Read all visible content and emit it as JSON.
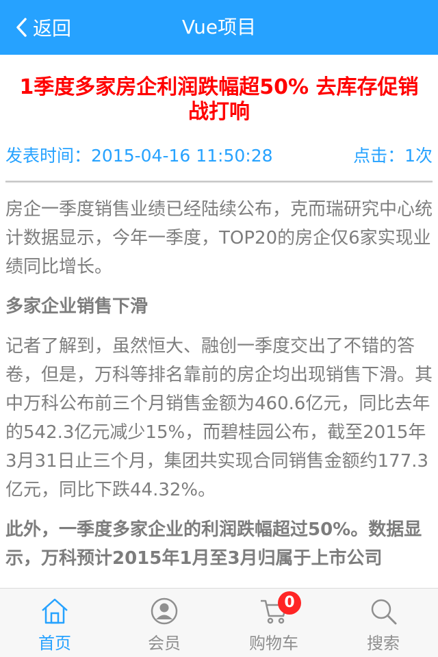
{
  "header": {
    "back_label": "返回",
    "title": "Vue项目",
    "accent": "#26a2ff"
  },
  "article": {
    "title": "1季度多家房企利润跌幅超50% 去库存促销战打响",
    "publish_time": "发表时间：2015-04-16 11:50:28",
    "clicks": "点击：1次",
    "paragraphs": [
      {
        "text": "房企一季度销售业绩已经陆续公布，克而瑞研究中心统计数据显示，今年一季度，TOP20的房企仅6家实现业绩同比增长。",
        "bold": false
      },
      {
        "text": "多家企业销售下滑",
        "bold": true
      },
      {
        "text": "记者了解到，虽然恒大、融创一季度交出了不错的答卷，但是，万科等排名靠前的房企均出现销售下滑。其中万科公布前三个月销售金额为460.6亿元，同比去年的542.3亿元减少15%，而碧桂园公布，截至2015年3月31日止三个月，集团共实现合同销售金额约177.3亿元，同比下跌44.32%。",
        "bold": false
      },
      {
        "text": "此外，一季度多家企业的利润跌幅超过50%。数据显示，万科预计2015年1月至3月归属于上市公司",
        "bold": true
      }
    ]
  },
  "tabbar": {
    "items": [
      {
        "label": "首页",
        "icon": "home-icon",
        "active": true
      },
      {
        "label": "会员",
        "icon": "user-icon",
        "active": false
      },
      {
        "label": "购物车",
        "icon": "cart-icon",
        "active": false,
        "badge": "0"
      },
      {
        "label": "搜索",
        "icon": "search-icon",
        "active": false
      }
    ]
  },
  "colors": {
    "title_red": "#ff0000",
    "body_gray": "#7d7d7d",
    "badge_red": "#ff2525"
  }
}
